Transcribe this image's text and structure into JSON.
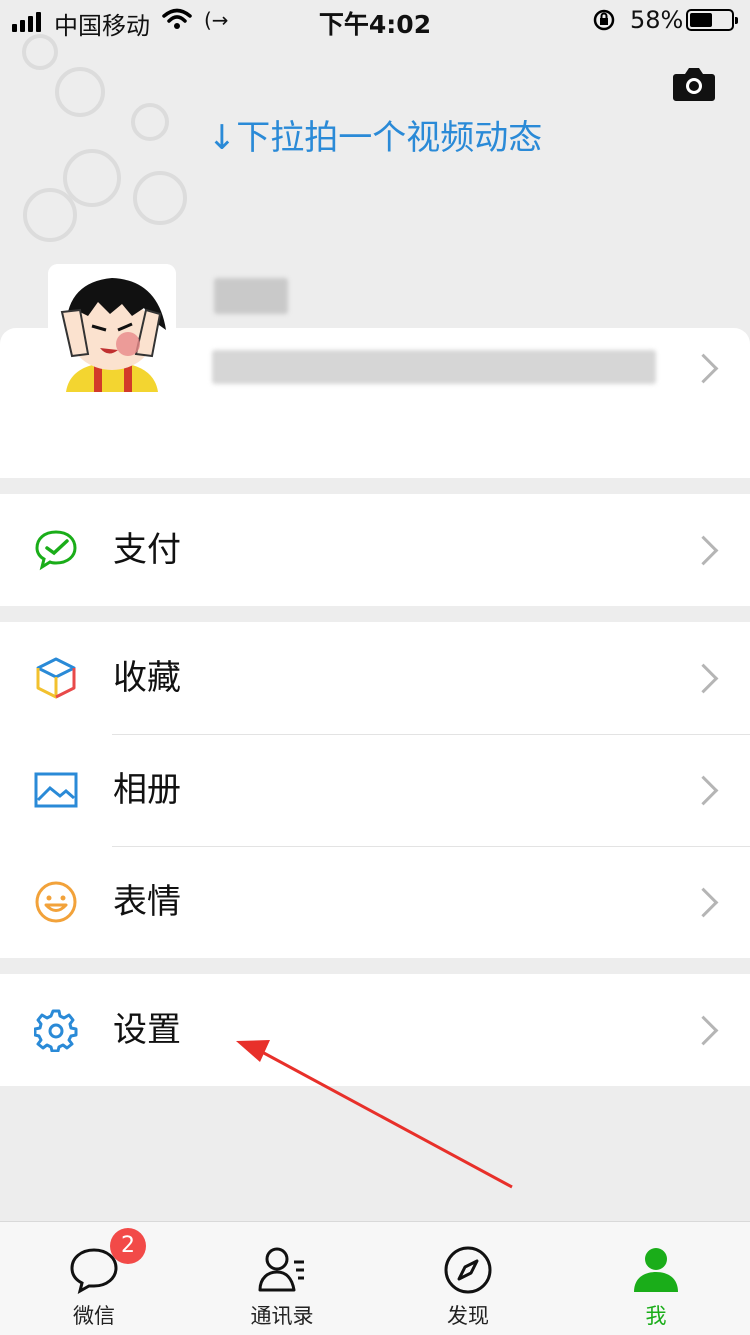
{
  "status_bar": {
    "carrier": "中国移动",
    "time": "下午4:02",
    "battery_percent": "58%",
    "battery_level": 0.58
  },
  "header": {
    "pull_hint": "↓下拉拍一个视频动态",
    "camera_icon": "camera-icon"
  },
  "profile": {
    "avatar_icon": "cartoon-avatar"
  },
  "menu": {
    "pay": {
      "label": "支付",
      "icon": "wechat-pay-icon",
      "color": "#1aad19"
    },
    "favorites": {
      "label": "收藏",
      "icon": "cube-icon"
    },
    "album": {
      "label": "相册",
      "icon": "image-icon",
      "color": "#2a8ad7"
    },
    "stickers": {
      "label": "表情",
      "icon": "smiley-icon",
      "color": "#f2a23a"
    },
    "settings": {
      "label": "设置",
      "icon": "gear-icon",
      "color": "#2a8ad7"
    }
  },
  "tabbar": {
    "tabs": [
      {
        "label": "微信",
        "icon": "chat-bubble-icon",
        "badge": "2"
      },
      {
        "label": "通讯录",
        "icon": "contacts-icon"
      },
      {
        "label": "发现",
        "icon": "compass-icon"
      },
      {
        "label": "我",
        "icon": "person-icon",
        "active": true,
        "color": "#1aad19"
      }
    ]
  }
}
